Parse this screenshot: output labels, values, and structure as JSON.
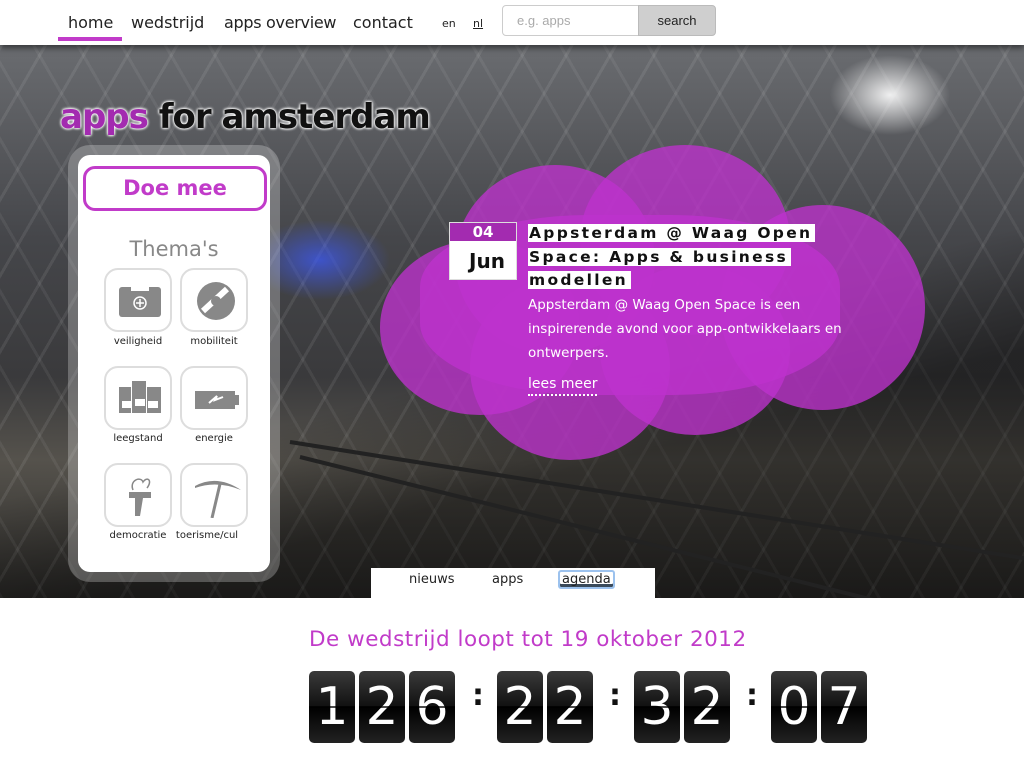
{
  "nav": {
    "items": [
      {
        "label": "home",
        "active": true
      },
      {
        "label": "wedstrijd"
      },
      {
        "label": "apps overview"
      },
      {
        "label": "contact"
      }
    ],
    "lang": [
      "en",
      "nl"
    ]
  },
  "search": {
    "placeholder": "e.g. apps",
    "button": "search"
  },
  "logo": {
    "part1": "apps",
    "part2": " for amsterdam"
  },
  "sidebar": {
    "cta": "Doe mee",
    "themes_title": "Thema's",
    "themes": [
      {
        "label": "veiligheid",
        "icon": "first-aid-kit-icon"
      },
      {
        "label": "mobiliteit",
        "icon": "steering-wheel-icon"
      },
      {
        "label": "leegstand",
        "icon": "protest-buildings-icon"
      },
      {
        "label": "energie",
        "icon": "battery-icon"
      },
      {
        "label": "democratie",
        "icon": "torch-icon"
      },
      {
        "label": "toerisme/cul",
        "icon": "pickaxe-icon"
      }
    ]
  },
  "event": {
    "day": "04",
    "month": "Jun",
    "title": "Appsterdam @ Waag Open Space: Apps & business modellen",
    "description": "Appsterdam @ Waag Open Space is een inspirerende avond voor app-ontwikkelaars en ontwerpers.",
    "more": "lees meer"
  },
  "tabs": [
    {
      "label": "nieuws"
    },
    {
      "label": "apps"
    },
    {
      "label": "agenda",
      "active": true
    }
  ],
  "countdown": {
    "title": "De wedstrijd loopt tot 19 oktober 2012",
    "days": "126",
    "hours": "22",
    "minutes": "32",
    "seconds": "07",
    "separator": ":"
  },
  "colors": {
    "accent": "#c13bc9",
    "dark_accent": "#a32bb0"
  }
}
